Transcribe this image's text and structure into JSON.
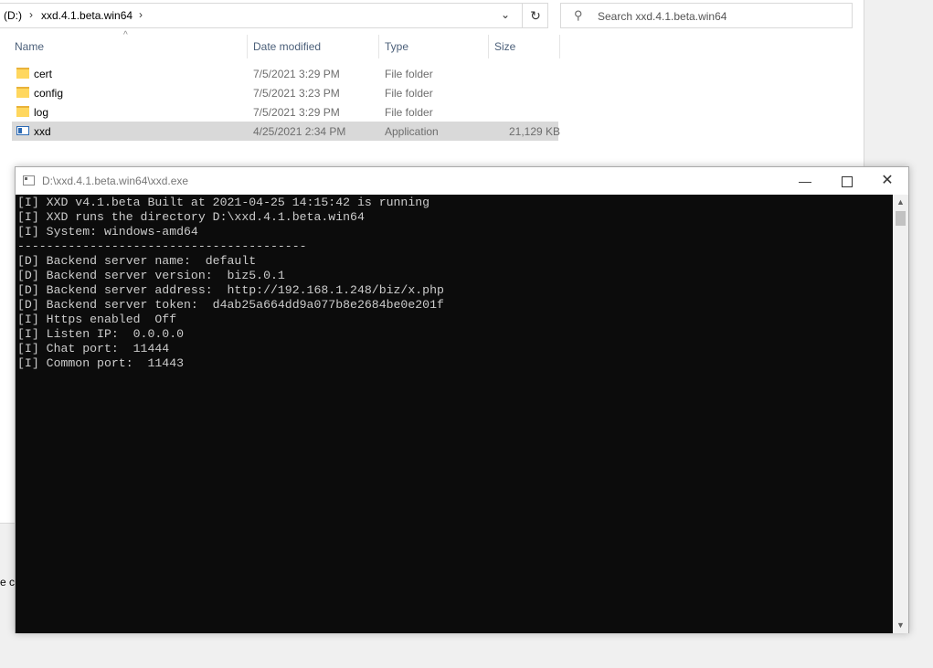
{
  "explorer": {
    "address": {
      "drive": "(D:)",
      "folder": "xxd.4.1.beta.win64",
      "chevron": "chevron-right-icon",
      "dropdown_icon": "chevron-down-icon",
      "refresh_icon": "refresh-icon"
    },
    "search": {
      "placeholder": "Search xxd.4.1.beta.win64",
      "icon": "search-icon"
    },
    "columns": {
      "name": "Name",
      "date": "Date modified",
      "type": "Type",
      "size": "Size"
    },
    "files": [
      {
        "name": "cert",
        "date": "7/5/2021 3:29 PM",
        "type": "File folder",
        "size": "",
        "icon": "folder-icon"
      },
      {
        "name": "config",
        "date": "7/5/2021 3:23 PM",
        "type": "File folder",
        "size": "",
        "icon": "folder-icon"
      },
      {
        "name": "log",
        "date": "7/5/2021 3:29 PM",
        "type": "File folder",
        "size": "",
        "icon": "folder-icon"
      },
      {
        "name": "xxd",
        "date": "4/25/2021 2:34 PM",
        "type": "Application",
        "size": "21,129 KB",
        "icon": "application-icon",
        "selected": true
      }
    ],
    "side_fragment": "e co"
  },
  "console": {
    "title": "D:\\xxd.4.1.beta.win64\\xxd.exe",
    "buttons": {
      "minimize": "—",
      "close": "✕"
    },
    "lines": [
      "[I] XXD v4.1.beta Built at 2021-04-25 14:15:42 is running",
      "[I] XXD runs the directory D:\\xxd.4.1.beta.win64",
      "[I] System: windows-amd64",
      "----------------------------------------",
      "[D] Backend server name:  default",
      "[D] Backend server version:  biz5.0.1",
      "[D] Backend server address:  http://192.168.1.248/biz/x.php",
      "[D] Backend server token:  d4ab25a664dd9a077b8e2684be0e201f",
      "[I] Https enabled  Off",
      "[I] Listen IP:  0.0.0.0",
      "[I] Chat port:  11444",
      "[I] Common port:  11443"
    ]
  }
}
